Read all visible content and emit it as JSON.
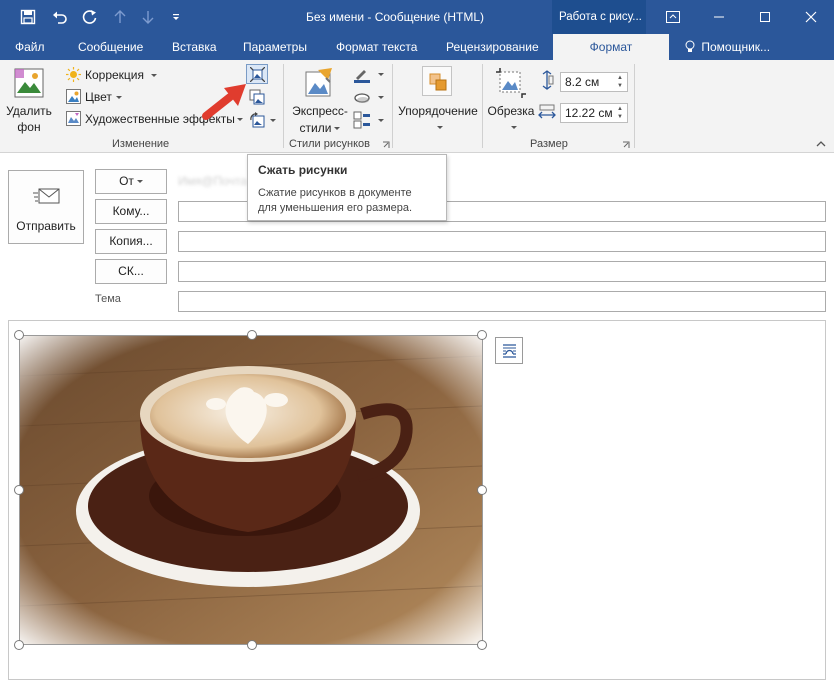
{
  "window": {
    "title": "Без имени - Сообщение (HTML)",
    "context_tab": "Работа с рису..."
  },
  "tabs": [
    "Файл",
    "Сообщение",
    "Вставка",
    "Параметры",
    "Формат текста",
    "Рецензирование",
    "Формат"
  ],
  "tell_me": "Помощник...",
  "ribbon": {
    "remove_bg_line1": "Удалить",
    "remove_bg_line2": "фон",
    "corrections": "Коррекция",
    "color": "Цвет",
    "artistic": "Художественные эффекты",
    "group_adjust": "Изменение",
    "quick_styles_line1": "Экспресс-",
    "quick_styles_line2": "стили",
    "group_styles": "Стили рисунков",
    "arrange": "Упорядочение",
    "crop": "Обрезка",
    "height": "8.2 см",
    "width": "12.22 см",
    "group_size": "Размер"
  },
  "compose": {
    "send": "Отправить",
    "from": "От",
    "to": "Кому...",
    "cc": "Копия...",
    "bcc": "СК...",
    "subject_label": "Тема",
    "from_value": "Имя@Почта"
  },
  "tooltip": {
    "title": "Сжать рисунки",
    "description_line1": "Сжатие рисунков в документе",
    "description_line2": "для уменьшения его размера."
  },
  "colors": {
    "accent": "#2b579a",
    "ribbon_bg": "#f3f3f3",
    "arrow": "#e74c3c"
  }
}
